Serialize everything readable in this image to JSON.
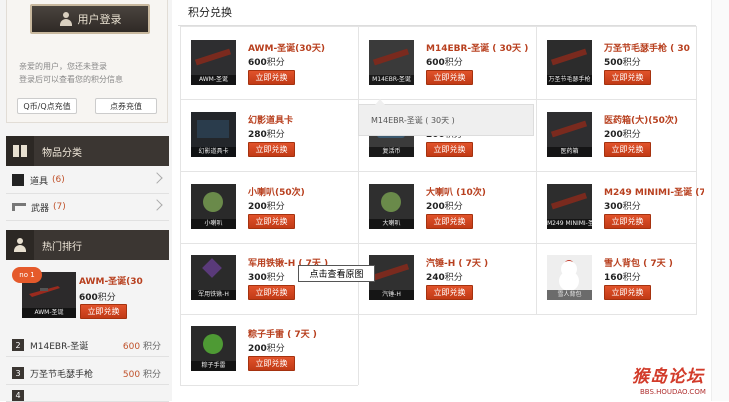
{
  "sidebar": {
    "login_button": "用户登录",
    "login_text_1": "亲爱的用户，您还未登录",
    "login_text_2": "登录后可以查看您的积分信息",
    "recharge_q": "Q币/Q点充值",
    "recharge_card": "点券充值",
    "categories_title": "物品分类",
    "categories": [
      {
        "label": "道具",
        "count": "(6)"
      },
      {
        "label": "武器",
        "count": "(7)"
      }
    ],
    "ranking_title": "热门排行",
    "rank_top": {
      "badge": "no 1",
      "name": "AWM-圣诞(30",
      "price": "600",
      "unit": "积分",
      "button": "立即兑换",
      "thumb": "AWM-圣诞"
    },
    "ranks": [
      {
        "num": "2",
        "name": "M14EBR-圣诞",
        "price": "600",
        "unit": "积分"
      },
      {
        "num": "3",
        "name": "万圣节毛瑟手枪",
        "price": "500",
        "unit": "积分"
      },
      {
        "num": "4",
        "name": "",
        "price": "",
        "unit": ""
      }
    ]
  },
  "main": {
    "title": "积分兑换",
    "unit": "积分",
    "button": "立即兑换",
    "items": [
      {
        "name": "AWM-圣诞(30天)",
        "price": "600",
        "thumb": "AWM-圣诞"
      },
      {
        "name": "M14EBR-圣诞 ( 30天 )",
        "price": "600",
        "thumb": "M14EBR-圣诞"
      },
      {
        "name": "万圣节毛瑟手枪 ( 30",
        "price": "500",
        "thumb": "万圣节毛瑟手枪"
      },
      {
        "name": "幻影道具卡",
        "price": "280",
        "thumb": "幻影道具卡"
      },
      {
        "name": "",
        "price": "200",
        "thumb": "复活币"
      },
      {
        "name": "医药箱(大)(50次)",
        "price": "200",
        "thumb": "医药箱"
      },
      {
        "name": "小喇叭(50次)",
        "price": "200",
        "thumb": "小喇叭"
      },
      {
        "name": "大喇叭 (10次)",
        "price": "200",
        "thumb": "大喇叭"
      },
      {
        "name": "M249 MINIMI-圣诞 (7",
        "price": "300",
        "thumb": "M249 MINIMI-圣诞"
      },
      {
        "name": "军用铁锹-H ( 7天 )",
        "price": "300",
        "thumb": "军用铁锹-H"
      },
      {
        "name": "汽锤-H ( 7天 )",
        "price": "240",
        "thumb": "汽锤-H"
      },
      {
        "name": "雪人背包 ( 7天 )",
        "price": "160",
        "thumb": "雪人背包"
      },
      {
        "name": "粽子手雷 ( 7天 )",
        "price": "200",
        "thumb": "粽子手雷"
      }
    ],
    "tooltip": "M14EBR-圣诞 ( 30天 )",
    "view_original": "点击查看原图"
  },
  "watermark": {
    "big": "猴岛论坛",
    "small": "BBS.HOUDAO.COM"
  },
  "colors": {
    "accent": "#c13a16",
    "header_dark": "#3b3632",
    "name_red": "#b8401f"
  }
}
